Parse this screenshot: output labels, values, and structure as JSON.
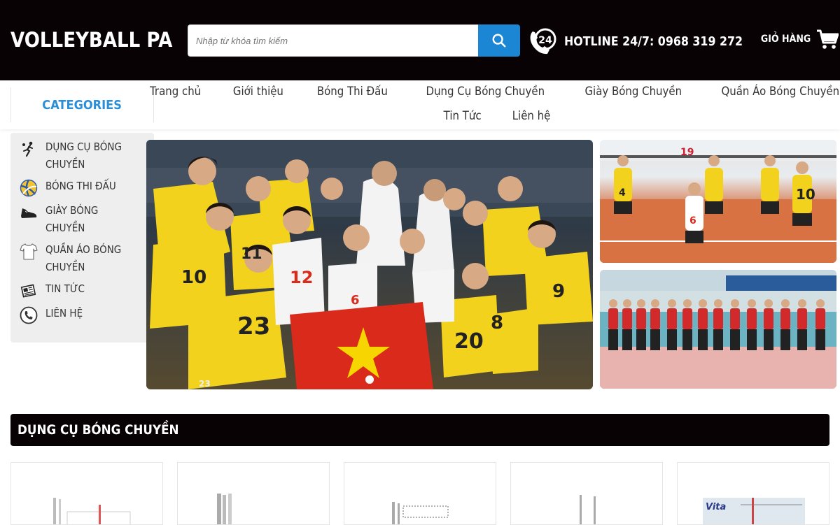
{
  "header": {
    "logo": "VOLLEYBALL PA",
    "search_placeholder": "Nhập từ khóa tìm kiếm",
    "hotline": "HOTLINE 24/7: 0968 319 272",
    "cart_label": "GIỎ HÀNG",
    "brand_color": "#080205",
    "accent_color": "#1b86d4"
  },
  "nav": {
    "categories_label": "CATEGORIES",
    "menu": [
      "Trang chủ",
      "Giới thiệu",
      "Bóng Thi Đấu",
      "Dụng Cụ Bóng Chuyền",
      "Giày Bóng Chuyền",
      "Quần Áo Bóng Chuyền",
      "Tin Tức",
      "Liên hệ"
    ]
  },
  "sidebar": {
    "items": [
      {
        "label": "Dụng cụ bóng chuyền",
        "icon": "volleyball-player-icon"
      },
      {
        "label": "Bóng thi đấu",
        "icon": "volleyball-icon"
      },
      {
        "label": "Giày bóng chuyền",
        "icon": "shoe-icon"
      },
      {
        "label": "Quần áo bóng chuyền",
        "icon": "shirt-icon"
      },
      {
        "label": "Tin tức",
        "icon": "newspaper-icon"
      },
      {
        "label": "Liên hệ",
        "icon": "phone-icon"
      }
    ]
  },
  "banner": {
    "hero_jersey_numbers": [
      "10",
      "23",
      "11",
      "12",
      "6",
      "20",
      "8",
      "9",
      "23"
    ],
    "thumb1_jersey_numbers": [
      "4",
      "6",
      "10",
      "19"
    ],
    "slide_dots": 1
  },
  "section": {
    "title": "DỤNG CỤ BÓNG CHUYỀN"
  },
  "products": {
    "count": 5,
    "card5_brand": "Vita"
  }
}
